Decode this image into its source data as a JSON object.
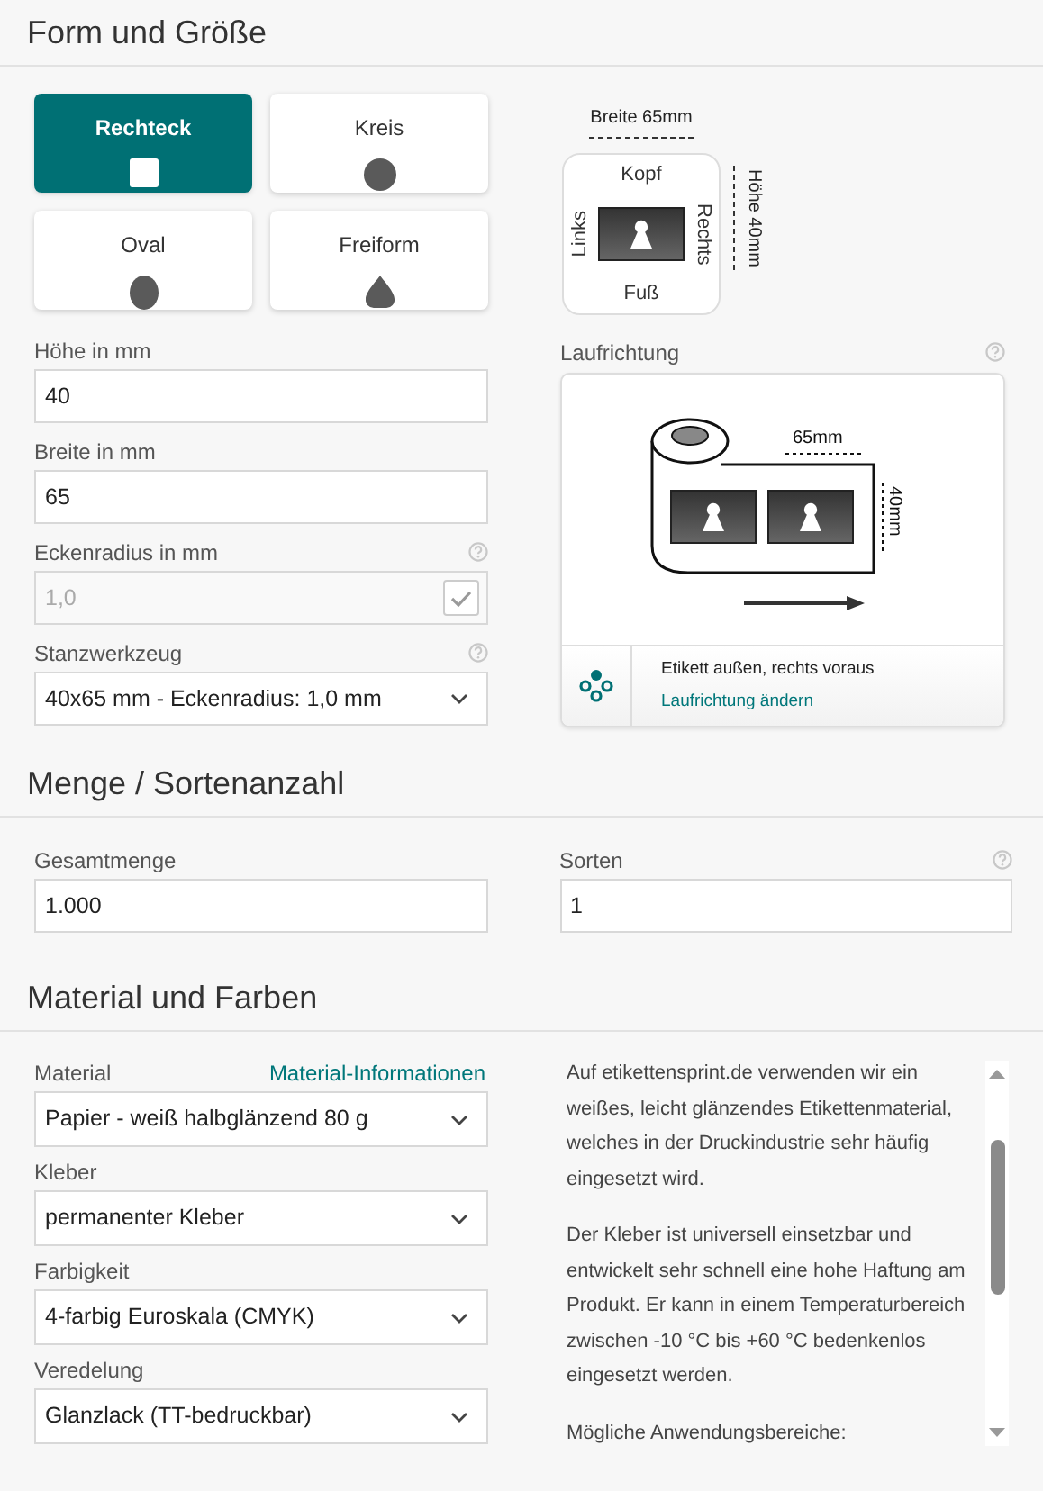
{
  "shape_section": {
    "title": "Form und Größe",
    "shapes": [
      {
        "label": "Rechteck",
        "kind": "rect",
        "selected": true
      },
      {
        "label": "Kreis",
        "kind": "circle",
        "selected": false
      },
      {
        "label": "Oval",
        "kind": "oval",
        "selected": false
      },
      {
        "label": "Freiform",
        "kind": "drop",
        "selected": false
      }
    ],
    "fields": [
      {
        "label": "Höhe in mm",
        "kind": "input",
        "value": "40",
        "help": false
      },
      {
        "label": "Breite in mm",
        "kind": "input",
        "value": "65",
        "help": false
      },
      {
        "label": "Eckenradius in mm",
        "kind": "check-input",
        "value": "1,0",
        "help": true,
        "disabled": true,
        "checked": true
      },
      {
        "label": "Stanzwerkzeug",
        "kind": "select",
        "value": "40x65 mm - Eckenradius: 1,0 mm",
        "help": true
      }
    ],
    "preview": {
      "width_label": "Breite 65mm",
      "top": "Kopf",
      "left": "Links",
      "right": "Rechts",
      "bottom": "Fuß",
      "height_label": "Höhe 40mm"
    },
    "direction": {
      "label": "Laufrichtung",
      "help": true,
      "width_label": "65mm",
      "height_label": "40mm",
      "status": "Etikett außen, rechts voraus",
      "link": "Laufrichtung ändern"
    }
  },
  "quantity_section": {
    "title": "Menge / Sortenanzahl",
    "fields": [
      {
        "label": "Gesamtmenge",
        "value": "1.000",
        "help": false
      },
      {
        "label": "Sorten",
        "value": "1",
        "help": true
      }
    ]
  },
  "material_section": {
    "title": "Material und Farben",
    "info_link": "Material-Informationen",
    "fields": [
      {
        "label": "Material",
        "value": "Papier - weiß halbglänzend 80 g"
      },
      {
        "label": "Kleber",
        "value": "permanenter Kleber"
      },
      {
        "label": "Farbigkeit",
        "value": "4-farbig Euroskala (CMYK)"
      },
      {
        "label": "Veredelung",
        "value": "Glanzlack (TT-bedruckbar)"
      }
    ],
    "description": [
      "Auf etikettensprint.de verwenden wir ein weißes, leicht glänzendes Etikettenmaterial, welches in der Druckindustrie sehr häufig eingesetzt wird.",
      "Der Kleber ist universell einsetzbar und entwickelt sehr schnell eine hohe Haftung am Produkt. Er kann in einem Temperaturbereich zwischen -10 °C bis +60 °C bedenkenlos eingesetzt werden.",
      "Mögliche Anwendungsbereiche:"
    ]
  }
}
